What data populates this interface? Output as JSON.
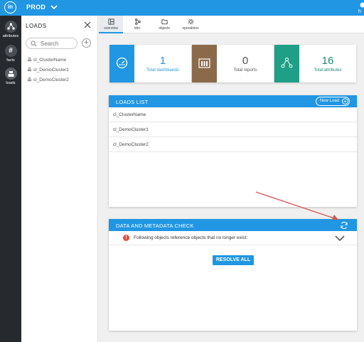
{
  "app": {
    "logo_text": "in",
    "environment": "PROD",
    "user_initial": "h"
  },
  "rail": {
    "items": [
      {
        "label": "attributes",
        "icon": "share-nodes-icon"
      },
      {
        "label": "facts",
        "icon": "hash-icon"
      },
      {
        "label": "loads",
        "icon": "stack-icon"
      }
    ]
  },
  "loads_panel": {
    "title": "LOADS",
    "search_placeholder": "Search",
    "items": [
      "cl_ClusterName",
      "cl_DemoCluster1",
      "cl_DemoCluster2"
    ]
  },
  "tabs": [
    {
      "label": "overview",
      "active": true
    },
    {
      "label": "ldm",
      "active": false
    },
    {
      "label": "objects",
      "active": false
    },
    {
      "label": "operations",
      "active": false
    }
  ],
  "stats": [
    {
      "value": "1",
      "label": "Total dashboards",
      "color": "#2196e3",
      "icon": "gauge-icon"
    },
    {
      "value": "0",
      "label": "Total reports",
      "color": "#8b6a4b",
      "icon": "bar-chart-icon"
    },
    {
      "value": "16",
      "label": "Total attributes",
      "color": "#1f9f85",
      "icon": "share-nodes-icon"
    }
  ],
  "loads_list": {
    "title": "LOADS LIST",
    "new_load_label": "New Load",
    "rows": [
      "cl_ClusterName",
      "cl_DemoCluster1",
      "cl_DemoCluster2"
    ]
  },
  "check": {
    "title": "DATA AND METADATA CHECK",
    "warning": "Following objects reference objects that no longer exist:",
    "resolve_label": "RESOLVE ALL"
  },
  "colors": {
    "accent": "#2196e3",
    "rail": "#262a2f",
    "annotation_arrow": "#d9534f"
  }
}
